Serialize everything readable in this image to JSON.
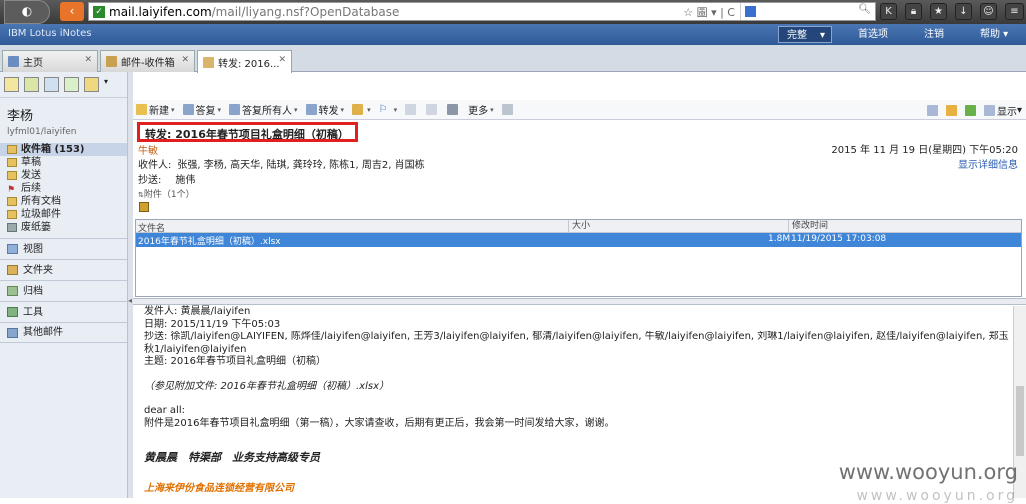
{
  "browser": {
    "url_domain": "mail.laiyifen.com",
    "url_path": "/mail/liyang.nsf?OpenDatabase",
    "url_tools": "☆ 圖 ▾ | C",
    "search_value": ""
  },
  "notes": {
    "brand": "IBM Lotus iNotes",
    "menu_complete": "完整",
    "menu_prefs": "首选项",
    "menu_logout": "注销",
    "menu_help": "帮助"
  },
  "tabs": [
    {
      "label": "主页"
    },
    {
      "label": "邮件-收件箱"
    },
    {
      "label": "转发: 2016..."
    }
  ],
  "sidebar": {
    "user_name": "李杨",
    "user_id": "lyfml01/laiyifen",
    "folders": [
      {
        "label": "收件箱 (153)"
      },
      {
        "label": "草稿"
      },
      {
        "label": "发送"
      },
      {
        "label": "后续"
      },
      {
        "label": "所有文档"
      },
      {
        "label": "垃圾邮件"
      },
      {
        "label": "废纸篓"
      }
    ],
    "sections": [
      {
        "label": "视图"
      },
      {
        "label": "文件夹"
      },
      {
        "label": "归档"
      },
      {
        "label": "工具"
      },
      {
        "label": "其他邮件"
      }
    ]
  },
  "toolbar": {
    "new": "新建",
    "reply": "答复",
    "reply_all": "答复所有人",
    "forward": "转发",
    "more": "更多",
    "display": "显示"
  },
  "message": {
    "subject": "转发: 2016年春节项目礼盒明细（初稿）",
    "sender": "牛敏",
    "date": "2015 年 11 月 19 日(星期四) 下午05:20",
    "show_details": "显示详细信息",
    "to_label": "收件人:",
    "to": "张强, 李杨, 高天华, 陆琪, 龚玲玲, 陈栋1, 周吉2, 肖国栋",
    "cc_label": "抄送:",
    "cc": "施伟",
    "attach_header": "附件（1个）"
  },
  "attachments": {
    "col_name": "文件名",
    "col_size": "大小",
    "col_modified": "修改时间",
    "rows": [
      {
        "name": "2016年春节礼盒明细（初稿）.xlsx",
        "size": "1.8M",
        "modified": "11/19/2015 17:03:08"
      }
    ]
  },
  "body": {
    "from_line": "发件人: 黄晨晨/laiyifen",
    "date_line": "日期: 2015/11/19 下午05:03",
    "cc_line": "抄送: 徐凯/laiyifen@LAIYIFEN, 陈烨佳/laiyifen@laiyifen, 王芳3/laiyifen@laiyifen, 郁清/laiyifen@laiyifen, 牛敏/laiyifen@laiyifen, 刘琳1/laiyifen@laiyifen, 赵佳/laiyifen@laiyifen, 郑玉",
    "cc_line2": "秋1/laiyifen@laiyifen",
    "subject_line": "主题: 2016年春节项目礼盒明细（初稿）",
    "attach_note": "（参见附加文件: 2016年春节礼盒明细（初稿）.xlsx）",
    "greeting": "dear all:",
    "content": "附件是2016年春节项目礼盒明细（第一稿），大家请查收，后期有更正后，我会第一时间发给大家，谢谢。",
    "signature": "黄晨晨　特渠部　业务支持高级专员",
    "company": "上海来伊份食品连锁经营有限公司"
  },
  "watermark": "www.wooyun.org",
  "watermark2": "www.wooyun.org"
}
